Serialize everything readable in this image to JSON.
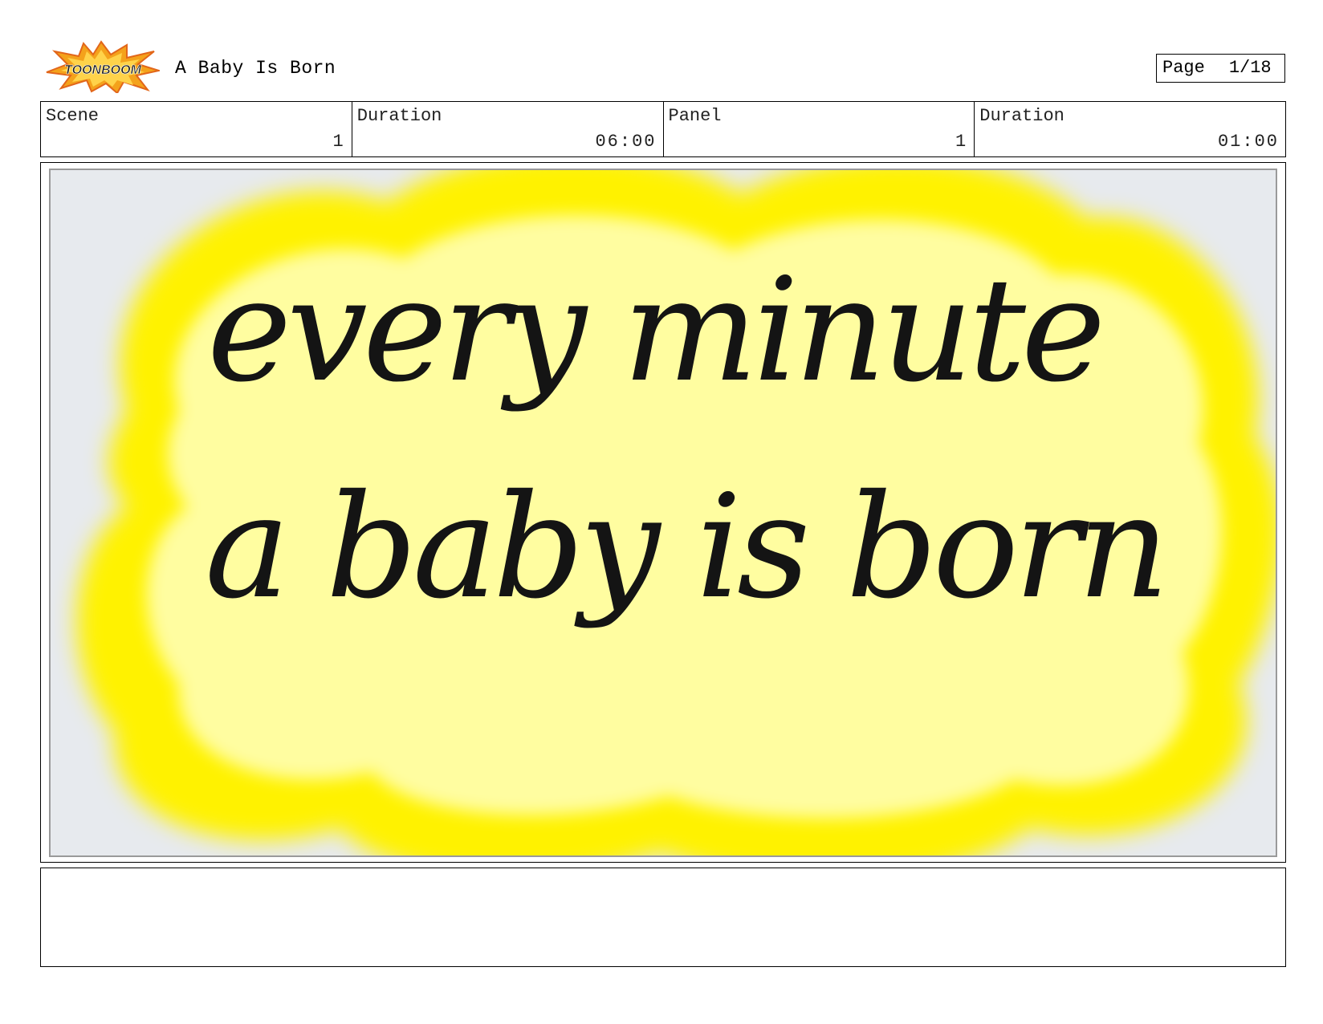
{
  "header": {
    "logo_icon": "toonboom-logo-icon",
    "logo_text": "TOONBOOM",
    "title": "A Baby Is Born",
    "page_label": "Page",
    "page_number": "1/18"
  },
  "info": {
    "scene_label": "Scene",
    "scene_value": "1",
    "scene_duration_label": "Duration",
    "scene_duration_value": "06:00",
    "panel_label": "Panel",
    "panel_value": "1",
    "panel_duration_label": "Duration",
    "panel_duration_value": "01:00"
  },
  "panel": {
    "handwritten_line_1": "every minute",
    "handwritten_line_2": "a baby is born",
    "background_color": "#e7eaee",
    "cloud_color": "#fffda0",
    "cloud_glow_color": "#fff200"
  },
  "notes": {
    "text": ""
  }
}
